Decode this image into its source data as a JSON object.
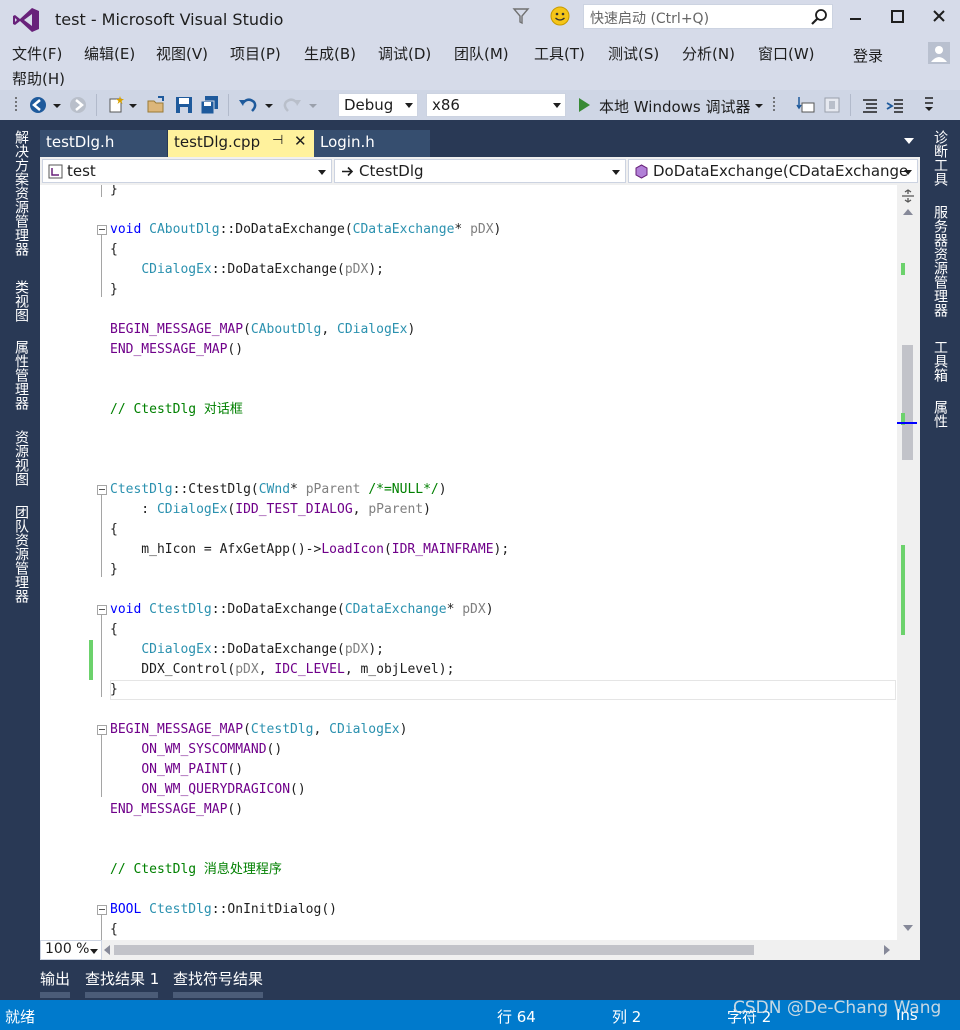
{
  "window": {
    "title": "test - Microsoft Visual Studio",
    "quick_launch_placeholder": "快速启动 (Ctrl+Q)"
  },
  "menu": {
    "items": [
      "文件(F)",
      "编辑(E)",
      "视图(V)",
      "项目(P)",
      "生成(B)",
      "调试(D)",
      "团队(M)",
      "工具(T)",
      "测试(S)",
      "分析(N)",
      "窗口(W)",
      "帮助(H)"
    ],
    "login": "登录"
  },
  "toolbar": {
    "config": "Debug",
    "platform": "x86",
    "debugger": "本地 Windows 调试器"
  },
  "left_rail": [
    "解决方案资源管理器",
    "类视图",
    "属性管理器",
    "资源视图",
    "团队资源管理器"
  ],
  "right_rail": [
    "诊断工具",
    "服务器资源管理器",
    "工具箱",
    "属性"
  ],
  "tabs": [
    {
      "label": "testDlg.h",
      "active": false
    },
    {
      "label": "testDlg.cpp",
      "active": true
    },
    {
      "label": "Login.h",
      "active": false
    }
  ],
  "tab_pin_glyph": "⊣",
  "tab_close_glyph": "✕",
  "navbar": {
    "project": "test",
    "class": "CtestDlg",
    "member": "DoDataExchange(CDataExchange"
  },
  "editor": {
    "zoom": "100 %"
  },
  "bottom_tabs": [
    "输出",
    "查找结果 1",
    "查找符号结果"
  ],
  "status": {
    "state": "就绪",
    "line": "行 64",
    "col": "列 2",
    "char": "字符 2",
    "mode": "Ins"
  },
  "watermark": "CSDN @De-Chang Wang",
  "colors": {
    "accent": "#007acc",
    "chrome": "#293955",
    "active_tab": "#fff29d",
    "keyword": "#0000ff",
    "type": "#2b91af",
    "macro": "#6f008a",
    "comment": "#008000",
    "change_bar": "#6cd26c"
  }
}
